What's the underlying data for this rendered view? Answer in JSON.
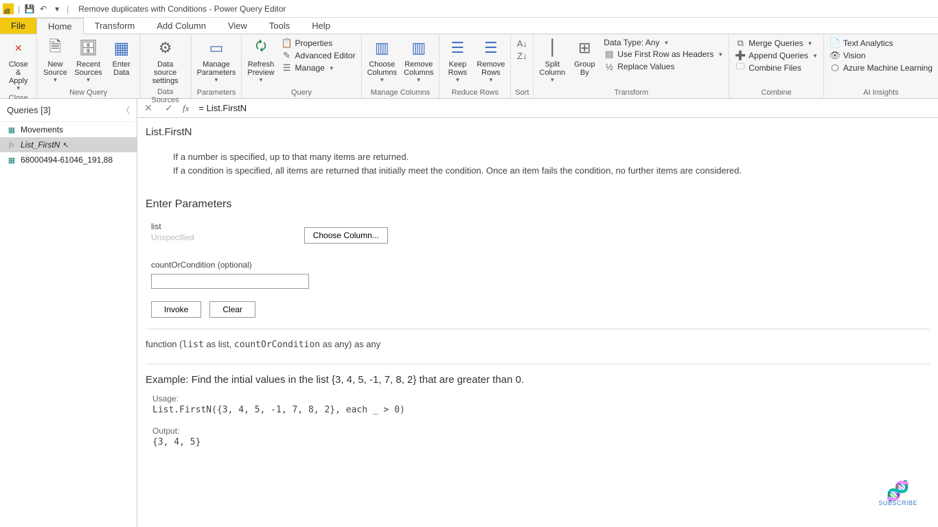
{
  "titlebar": {
    "title": "Remove duplicates with Conditions - Power Query Editor"
  },
  "tabs": {
    "file": "File",
    "home": "Home",
    "transform": "Transform",
    "addcolumn": "Add Column",
    "view": "View",
    "tools": "Tools",
    "help": "Help"
  },
  "ribbon": {
    "close": {
      "btn": "Close &\nApply",
      "group": "Close"
    },
    "newquery": {
      "newsource": "New\nSource",
      "recent": "Recent\nSources",
      "enter": "Enter\nData",
      "group": "New Query"
    },
    "datasources": {
      "settings": "Data source\nsettings",
      "group": "Data Sources"
    },
    "parameters": {
      "manage": "Manage\nParameters",
      "group": "Parameters"
    },
    "query": {
      "refresh": "Refresh\nPreview",
      "properties": "Properties",
      "advanced": "Advanced Editor",
      "manage": "Manage",
      "group": "Query"
    },
    "managecols": {
      "choose": "Choose\nColumns",
      "remove": "Remove\nColumns",
      "group": "Manage Columns"
    },
    "reducerows": {
      "keep": "Keep\nRows",
      "remove": "Remove\nRows",
      "group": "Reduce Rows"
    },
    "sort": {
      "group": "Sort"
    },
    "transform": {
      "split": "Split\nColumn",
      "group_by": "Group\nBy",
      "datatype": "Data Type: Any",
      "firstrow": "Use First Row as Headers",
      "replace": "Replace Values",
      "group": "Transform"
    },
    "combine": {
      "merge": "Merge Queries",
      "append": "Append Queries",
      "combine": "Combine Files",
      "group": "Combine"
    },
    "ai": {
      "text": "Text Analytics",
      "vision": "Vision",
      "ml": "Azure Machine Learning",
      "group": "AI Insights"
    }
  },
  "queries": {
    "header": "Queries [3]",
    "items": [
      {
        "name": "Movements",
        "kind": "table"
      },
      {
        "name": "List_FirstN",
        "kind": "fx"
      },
      {
        "name": "68000494-61046_191,88",
        "kind": "table"
      }
    ]
  },
  "formula": {
    "value": "= List.FirstN"
  },
  "doc": {
    "title": "List.FirstN",
    "desc1": "If a number is specified, up to that many items are returned.",
    "desc2": "If a condition is specified, all items are returned that initially meet the condition. Once an item fails the condition, no further items are considered.",
    "enter": "Enter Parameters",
    "param_list": "list",
    "param_list_ph": "Unspecified",
    "choose_column": "Choose Column...",
    "param_count": "countOrCondition (optional)",
    "invoke": "Invoke",
    "clear": "Clear",
    "sig_prefix": "function (",
    "sig_list": "list",
    "sig_mid": " as list, ",
    "sig_cond": "countOrCondition",
    "sig_suffix": " as any) as any",
    "example": "Example: Find the intial values in the list {3, 4, 5, -1, 7, 8, 2} that are greater than 0.",
    "usage": "Usage:",
    "usage_code": "List.FirstN({3, 4, 5, -1, 7, 8, 2}, each _ > 0)",
    "output": "Output:",
    "output_code": "{3, 4, 5}"
  },
  "subscribe": "SUBSCRIBE"
}
